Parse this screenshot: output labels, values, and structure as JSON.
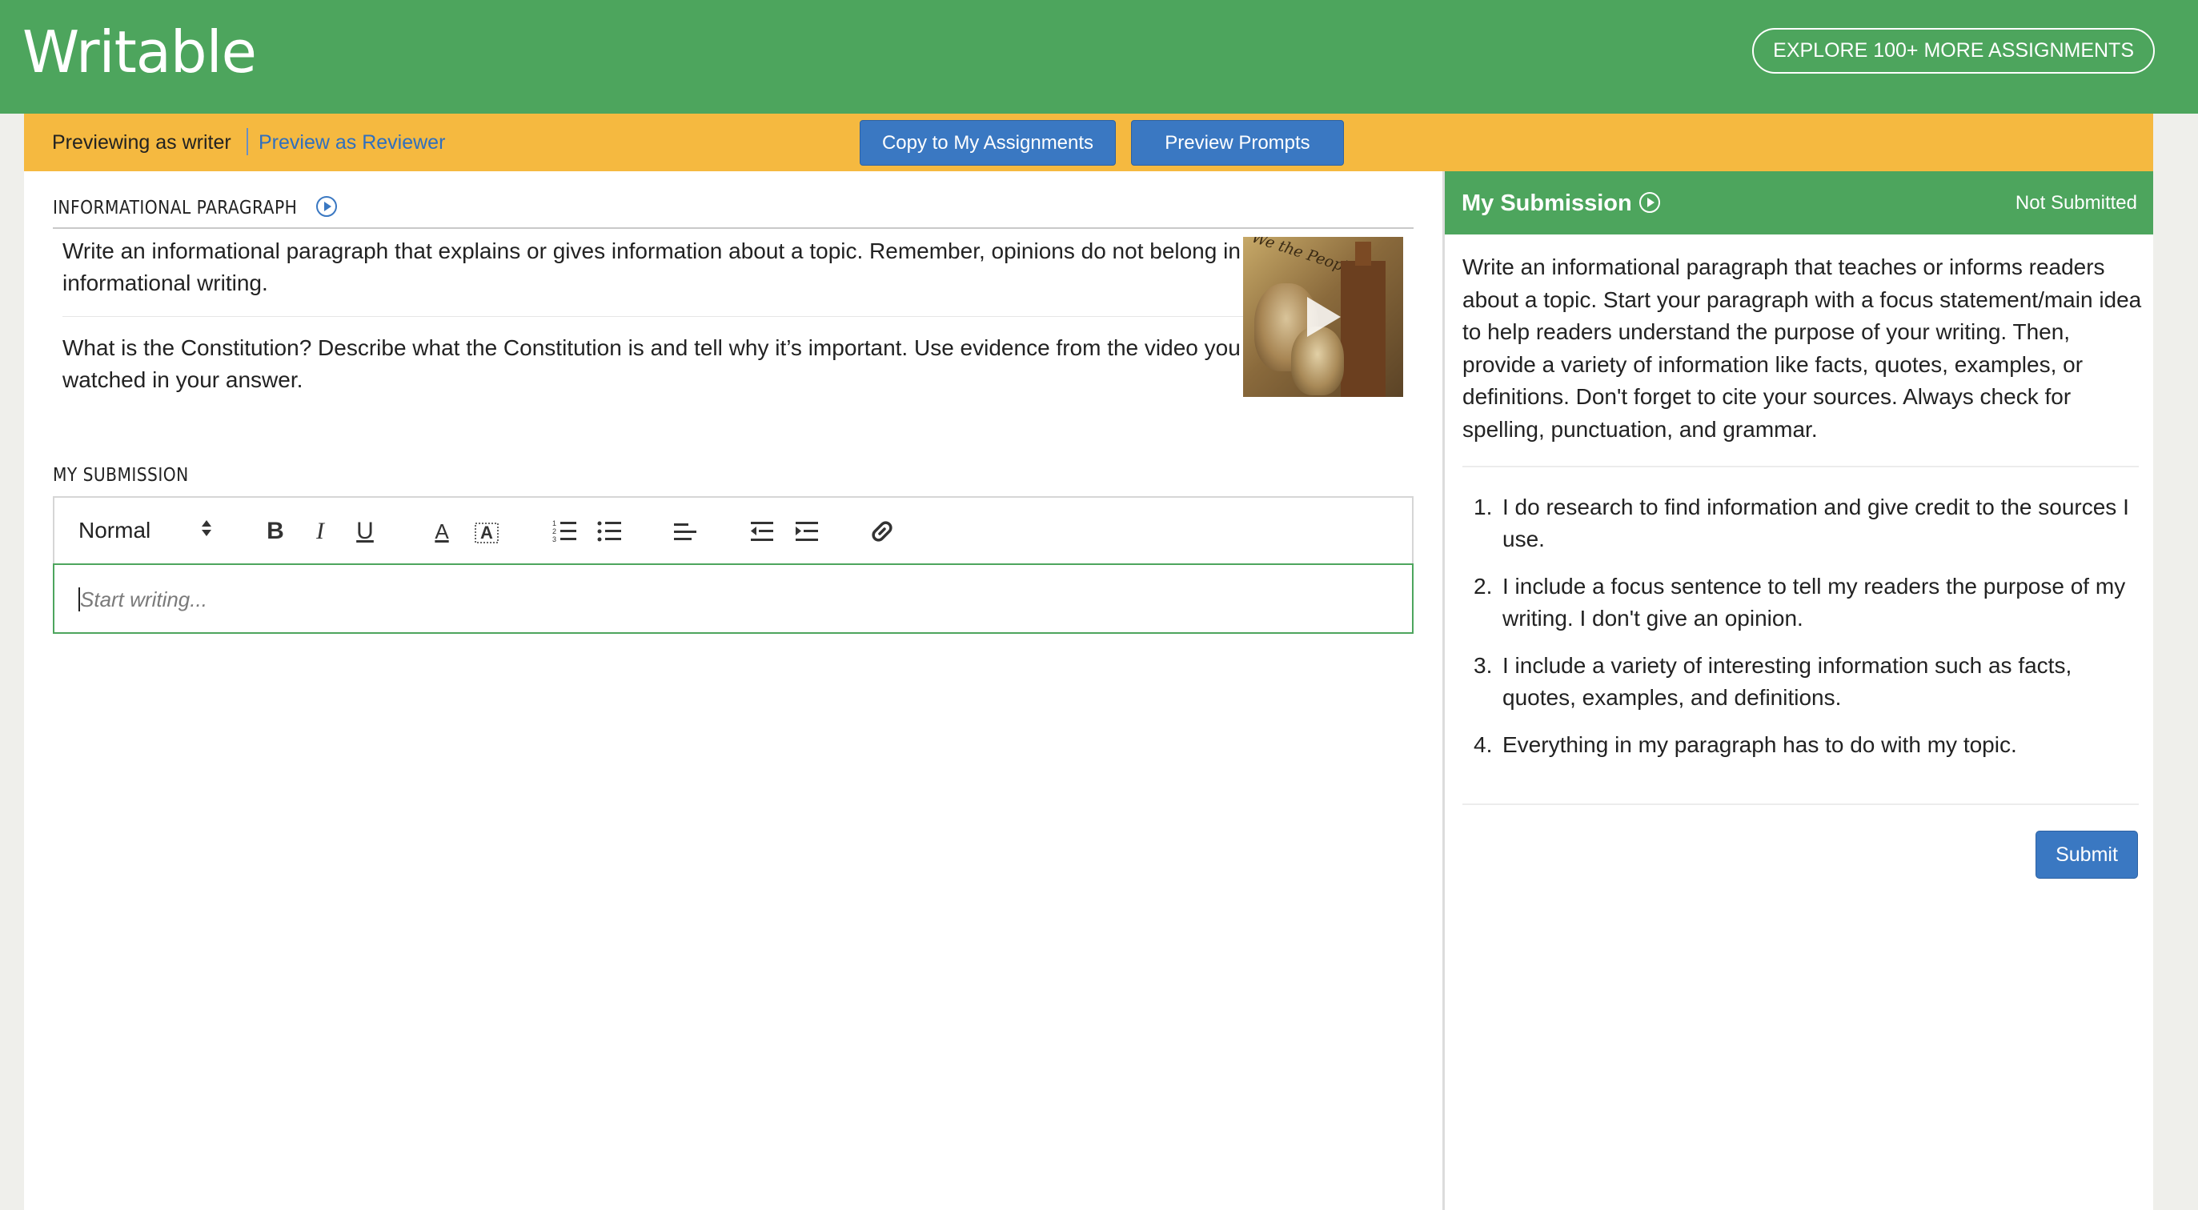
{
  "header": {
    "logo": "Writable",
    "explore_label": "EXPLORE 100+ MORE ASSIGNMENTS"
  },
  "preview_bar": {
    "writer_label": "Previewing as writer",
    "reviewer_link": "Preview as Reviewer",
    "copy_button": "Copy to My Assignments",
    "prompts_button": "Preview Prompts"
  },
  "assignment": {
    "section_title": "INFORMATIONAL PARAGRAPH",
    "prompt_1": "Write an informational paragraph that explains or gives information about a topic. Remember, opinions do not belong in informational writing.",
    "prompt_2": "What is the Constitution? Describe what the Constitution is and tell why it’s important. Use evidence from the video you watched in your answer.",
    "thumbnail_text": "We the People"
  },
  "submission": {
    "section_title": "MY SUBMISSION",
    "format_select": "Normal",
    "placeholder": "Start writing..."
  },
  "side_panel": {
    "title": "My Submission",
    "status": "Not Submitted",
    "description": "Write an informational paragraph that teaches or informs readers about a topic. Start your paragraph with a focus statement/main idea to help readers understand the purpose of your writing. Then, provide a variety of information like facts, quotes, examples, or definitions. Don't forget to cite your sources. Always check for spelling, punctuation, and grammar.",
    "criteria": [
      {
        "num": "1.",
        "text": "I do research to find information and give credit to the sources I use."
      },
      {
        "num": "2.",
        "text": "I include a focus sentence to tell my readers the purpose of my writing. I don't give an opinion."
      },
      {
        "num": "3.",
        "text": "I include a variety of interesting information such as facts, quotes, examples, and definitions."
      },
      {
        "num": "4.",
        "text": "Everything in my paragraph has to do with my topic."
      }
    ],
    "submit_label": "Submit"
  },
  "colors": {
    "brand_green": "#4da55d",
    "preview_yellow": "#f5b940",
    "button_blue": "#3a78c2",
    "link_blue": "#2f6fbf"
  },
  "icons": [
    "play-circle-icon",
    "bold-icon",
    "italic-icon",
    "underline-icon",
    "text-color-icon",
    "background-color-icon",
    "ordered-list-icon",
    "bullet-list-icon",
    "align-left-icon",
    "outdent-icon",
    "indent-icon",
    "link-icon",
    "video-play-icon"
  ]
}
